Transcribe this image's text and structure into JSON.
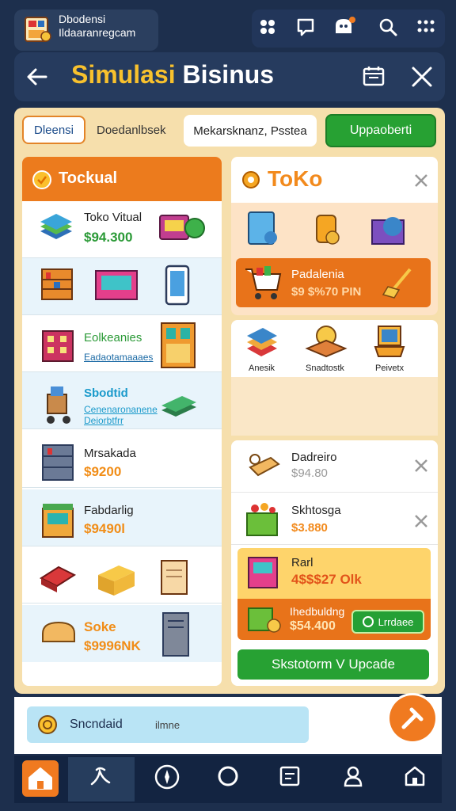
{
  "app": {
    "name_line1": "Dbodensi",
    "name_line2": "Ildaaranregcam"
  },
  "header": {
    "title_part1": "Simulasi",
    "title_part2": "Bisinus"
  },
  "tabs": [
    {
      "label": "Dleensi"
    },
    {
      "label": "Doedanlbsek"
    },
    {
      "label": "Mekarsknanz, Psstea"
    },
    {
      "label": "Uppaoberti"
    }
  ],
  "left_panel": {
    "title": "Tockual",
    "rows": [
      {
        "name": "Toko Vitual",
        "price": "$94.300"
      },
      {
        "name": "",
        "price": ""
      },
      {
        "name": "Eolkeanies",
        "sub": "Eadaotamaaaes"
      },
      {
        "name": "Sbodtid",
        "sub": "Cenenaronanene Deiorbtfrr"
      },
      {
        "name": "Mrsakada",
        "price": "$9200"
      },
      {
        "name": "Fabdarlig",
        "price": "$9490l"
      },
      {
        "name": "",
        "price": ""
      },
      {
        "name": "Soke",
        "price": "$9996NK"
      }
    ]
  },
  "right_panel": {
    "title": "ToKo",
    "promo_name": "Padalenia",
    "promo_price": "$9 $%70 PIN",
    "items_labels": [
      "Anesik",
      "Snadtostk",
      "Peivetx"
    ]
  },
  "cart": {
    "rows": [
      {
        "name": "Dadreiro",
        "price": "$94.80"
      },
      {
        "name": "Skhtosga",
        "price": "$3.880"
      }
    ],
    "yellow": {
      "name": "Rarl",
      "price": "4$$$27 Olk"
    },
    "orange": {
      "name": "Ihedbuldng",
      "price": "$54.400",
      "button": "Lrrdaee"
    },
    "main_button": "Skstotorm V Upcade"
  },
  "notification": {
    "text": "Sncndaid",
    "text2": "ilmne"
  },
  "colors": {
    "bg": "#1d2f4d",
    "accent_orange": "#ec7b1d",
    "accent_green": "#27a133",
    "title_yellow": "#f8c12d"
  }
}
